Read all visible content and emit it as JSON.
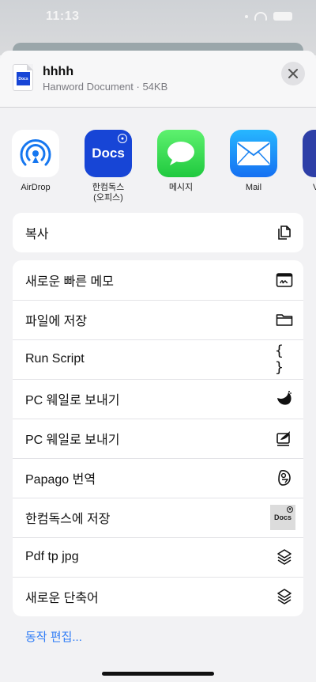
{
  "status_bar": {
    "time": "11:13"
  },
  "share_sheet": {
    "file": {
      "name": "hhhh",
      "meta": "Hanword Document · 54KB",
      "thumb_logo": "Docs"
    },
    "close_icon": "close-icon",
    "apps": [
      {
        "label": "AirDrop",
        "icon": "airdrop-icon"
      },
      {
        "label": "한컴독스\n(오피스)",
        "icon_text": "Docs",
        "icon": "hancom-docs-icon"
      },
      {
        "label": "메시지",
        "icon": "messages-icon"
      },
      {
        "label": "Mail",
        "icon": "mail-icon"
      },
      {
        "label": "V",
        "icon": "partial-app-icon"
      }
    ],
    "copy_group": [
      {
        "label": "복사",
        "icon": "copy-icon"
      }
    ],
    "actions": [
      {
        "label": "새로운 빠른 메모",
        "icon": "quick-note-icon"
      },
      {
        "label": "파일에 저장",
        "icon": "folder-icon"
      },
      {
        "label": "Run Script",
        "icon": "braces-icon",
        "icon_text": "{ }"
      },
      {
        "label": "PC 웨일로 보내기",
        "icon": "whale-icon"
      },
      {
        "label": "PC 웨일로 보내기",
        "icon": "whale-send-icon"
      },
      {
        "label": "Papago 번역",
        "icon": "papago-icon"
      },
      {
        "label": "한컴독스에 저장",
        "icon": "hancom-docs-thumb-icon",
        "icon_text": "Docs"
      },
      {
        "label": "Pdf tp jpg",
        "icon": "shortcuts-icon"
      },
      {
        "label": "새로운 단축어",
        "icon": "shortcuts-icon"
      }
    ],
    "edit_actions_label": "동작 편집..."
  }
}
